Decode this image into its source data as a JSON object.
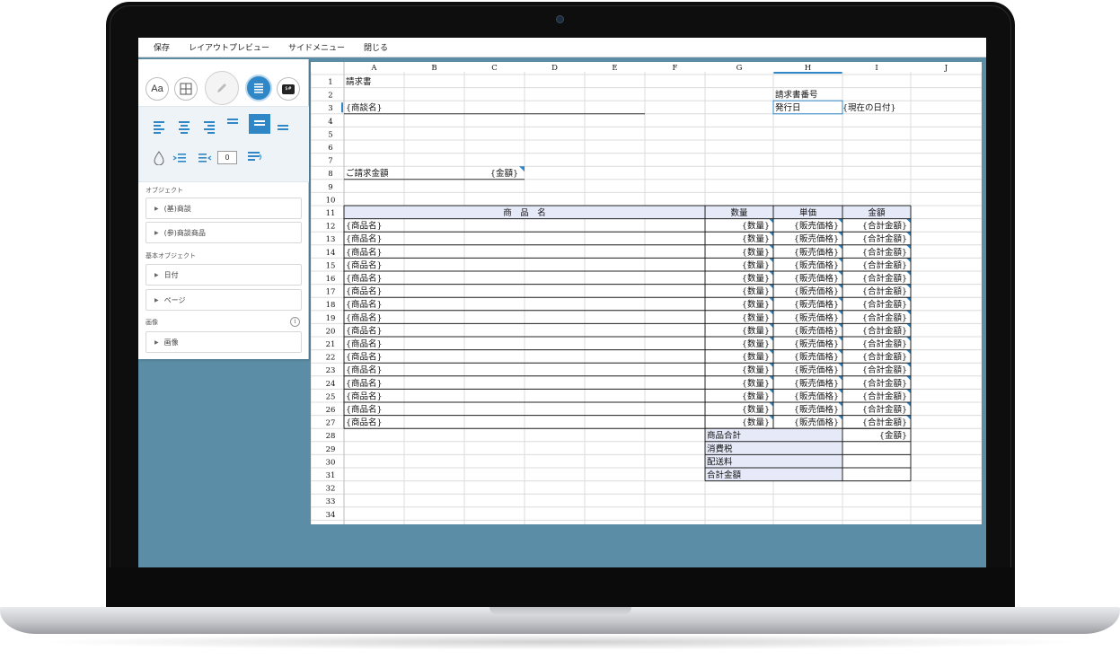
{
  "menu": {
    "save": "保存",
    "layout_preview": "レイアウトプレビュー",
    "side_menu": "サイドメニュー",
    "close": "閉じる"
  },
  "toolbar": {
    "font_button": "Aa",
    "number_box": "0",
    "dollar_icon_text": "$#"
  },
  "sidebar": {
    "objects_label": "オブジェクト",
    "objects": [
      "(基)商談",
      "(参)商談商品"
    ],
    "basic_objects_label": "基本オブジェクト",
    "basic_objects": [
      "日付",
      "ページ"
    ],
    "image_label": "画像",
    "images": [
      "画像"
    ],
    "info_icon": "i"
  },
  "sheet": {
    "columns": [
      "A",
      "B",
      "C",
      "D",
      "E",
      "F",
      "G",
      "H",
      "I",
      "J"
    ],
    "selected_column": "H",
    "row_count": 34,
    "title": "請求書",
    "invoice_number_label": "請求書番号",
    "deal_name": "{商談名}",
    "issue_date_label": "発行日",
    "current_date": "{現在の日付}",
    "billing_amount_label": "ご請求金額",
    "amount_field": "{金額}",
    "table_headers": [
      "商　品　名",
      "数量",
      "単価",
      "金額"
    ],
    "item_name": "{商品名}",
    "item_qty": "{数量}",
    "item_price": "{販売価格}",
    "item_total": "{合計金額}",
    "item_row_count": 16,
    "summary_labels": [
      "商品合計",
      "消費税",
      "配送料",
      "合計金額"
    ],
    "summary_amount": "{金額}"
  },
  "colors": {
    "screen_background": "#5b8ea6",
    "accent_blue": "#2f87c8",
    "header_fill": "#e6e9f8",
    "grid_line": "#dcdcdc"
  }
}
